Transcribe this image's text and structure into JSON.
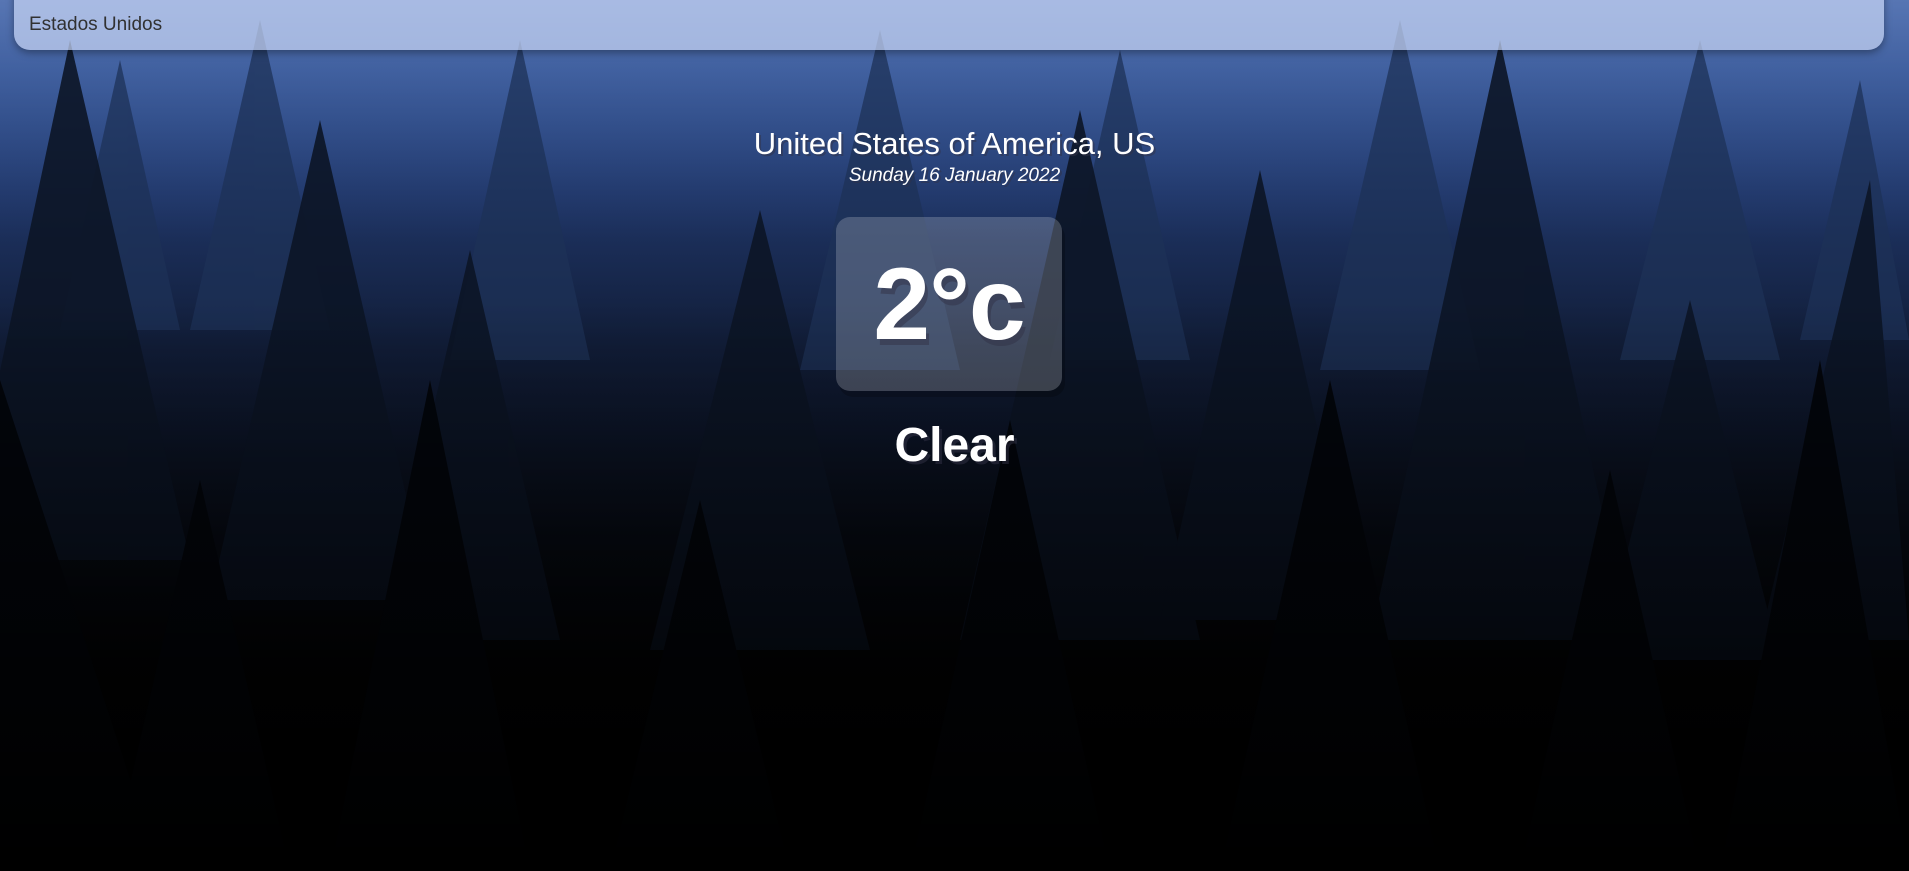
{
  "search": {
    "placeholder": "Estados Unidos"
  },
  "location": {
    "name": "United States of America, US",
    "date": "Sunday 16 January 2022"
  },
  "weather": {
    "temperature": "2°c",
    "condition": "Clear"
  },
  "colors": {
    "sky_top": "#3a5a9a",
    "sky_mid": "#1f3566",
    "ground": "#000000",
    "text": "#ffffff",
    "search_text": "#313131"
  }
}
